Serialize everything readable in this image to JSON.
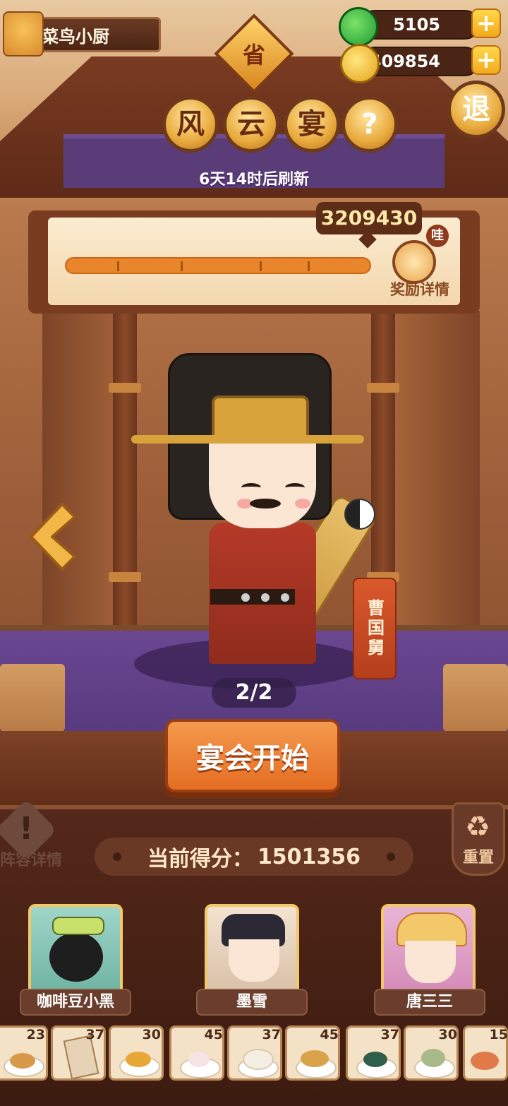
{
  "player": {
    "name": "菜鸟小厨"
  },
  "resources": {
    "jade": "5105",
    "coins": "15409854",
    "plus": "+"
  },
  "badge": {
    "province": "省"
  },
  "title": {
    "chars": [
      "风",
      "云",
      "宴"
    ],
    "help": "?"
  },
  "exit": {
    "label": "退"
  },
  "refresh_text": "6天14时后刷新",
  "progress": {
    "target_score": "3209430",
    "fill_fraction": 1.0,
    "reward_label": "奖励详情",
    "reward_badge": "哇"
  },
  "character": {
    "name": "曹国舅",
    "page": "2/2"
  },
  "start_button": "宴会开始",
  "current_score": {
    "label": "当前得分：",
    "value": "1501356"
  },
  "lineup": {
    "label": "阵容详情"
  },
  "reset": {
    "label": "重置"
  },
  "chefs": [
    {
      "name": "咖啡豆小黑"
    },
    {
      "name": "墨雪"
    },
    {
      "name": "唐三三"
    }
  ],
  "dishes": [
    {
      "count": "23"
    },
    {
      "count": "37"
    },
    {
      "count": "30"
    },
    {
      "count": "45"
    },
    {
      "count": "37"
    },
    {
      "count": "45"
    },
    {
      "count": "37"
    },
    {
      "count": "30"
    },
    {
      "count": "15"
    }
  ],
  "colors": {
    "accent_orange": "#e46d22",
    "gold": "#f2c86a",
    "stage_purple": "#6b4792"
  }
}
